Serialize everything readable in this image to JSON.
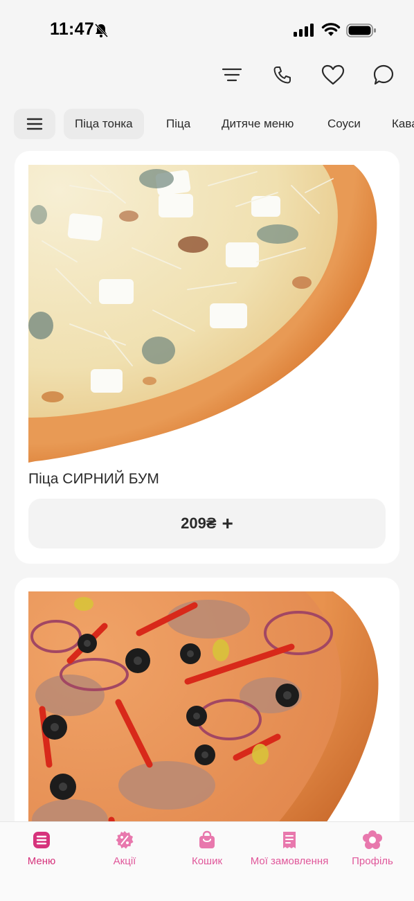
{
  "status_bar": {
    "time": "11:47"
  },
  "top_actions": [
    {
      "name": "filter",
      "icon": "filter-lines-icon"
    },
    {
      "name": "phone",
      "icon": "phone-icon"
    },
    {
      "name": "favorites",
      "icon": "heart-icon"
    },
    {
      "name": "chat",
      "icon": "chat-bubble-icon"
    }
  ],
  "categories": {
    "menu_icon": "hamburger-icon",
    "tabs": [
      {
        "label": "Піца тонка",
        "active": true
      },
      {
        "label": "Піца",
        "active": false
      },
      {
        "label": "Дитяче меню",
        "active": false
      },
      {
        "label": "Соуси",
        "active": false
      },
      {
        "label": "Кава",
        "active": false
      }
    ]
  },
  "products": [
    {
      "title": "Піца СИРНИЙ БУМ",
      "price": "209₴",
      "add_icon": "plus-icon"
    },
    {
      "title": "",
      "price": "",
      "add_icon": "plus-icon"
    }
  ],
  "bottom_nav": {
    "items": [
      {
        "label": "Меню",
        "icon": "menu-list-icon",
        "active": true
      },
      {
        "label": "Акції",
        "icon": "percent-badge-icon",
        "active": false
      },
      {
        "label": "Кошик",
        "icon": "shopping-bag-icon",
        "active": false
      },
      {
        "label": "Мої замовлення",
        "icon": "receipt-icon",
        "active": false
      },
      {
        "label": "Профіль",
        "icon": "profile-flower-icon",
        "active": false
      }
    ]
  },
  "colors": {
    "accent": "#e0579a",
    "accent_dark": "#d6337c",
    "background": "#f5f5f5",
    "card": "#ffffff",
    "chip": "#ebebeb"
  }
}
